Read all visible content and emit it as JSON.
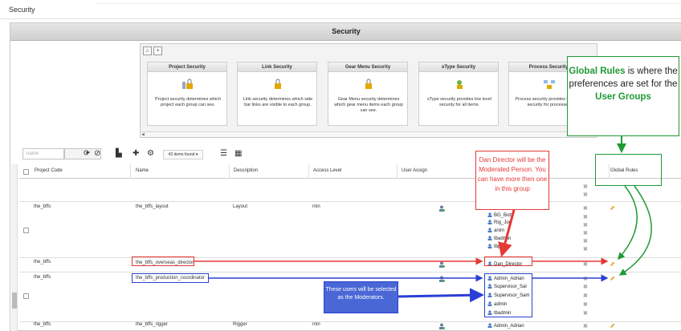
{
  "page": {
    "title": "Security"
  },
  "panel": {
    "title": "Security"
  },
  "carousel": {
    "home_label": "⌂",
    "add_label": "+",
    "cards": [
      {
        "title": "Project Security",
        "desc": "Project security determines which project each group can see."
      },
      {
        "title": "Link Security",
        "desc": "Link security determines which side bar links are visible to each group."
      },
      {
        "title": "Gear Menu Security",
        "desc": "Gear Menu security determines which gear menu items each group can see."
      },
      {
        "title": "sType Security",
        "desc": "sType security provides low level security for all items."
      },
      {
        "title": "Process Security",
        "desc": "Process security provides low level security for processes."
      }
    ]
  },
  "toolbar": {
    "search_placeholder": "name",
    "items_found": "43 items found ▾"
  },
  "grid": {
    "columns": [
      "Project Code",
      "Name",
      "Description",
      "Access Level",
      "User Assign",
      "Global Rules"
    ],
    "rows": [
      {
        "project": "the_bffs",
        "name": "the_bffs_layout",
        "description": "Layout",
        "access": "min",
        "users": [
          "BG_Bob",
          "Rig_Joe",
          "anim",
          "tbadmin",
          "tbprodu"
        ]
      },
      {
        "project": "the_bffs",
        "name": "the_bffs_overseas_director",
        "description": "",
        "access": "",
        "users": [
          "Dan_Director"
        ]
      },
      {
        "project": "the_bffs",
        "name": "the_bffs_production_coordinator",
        "description": "",
        "access": "",
        "users": [
          "Admin_Adrian",
          "Supervisor_Sal",
          "Supervisor_Sam",
          "admin",
          "tbadmin"
        ]
      },
      {
        "project": "the_bffs",
        "name": "the_bffs_rigger",
        "description": "Rigger",
        "access": "min",
        "users": [
          "Admin_Adrian"
        ]
      }
    ]
  },
  "annotations": {
    "green_intro": "Global Rules",
    "green_mid": " is where the preferences are set for the ",
    "green_emph": "User Groups",
    "red_text": "Dan Director will be the Moderated Person. You can have more then one in this group",
    "blue_text": "These users will be selected as the Moderators."
  },
  "colors": {
    "red": "#e53935",
    "blue": "#2a3fd4",
    "green": "#1f9a35"
  }
}
